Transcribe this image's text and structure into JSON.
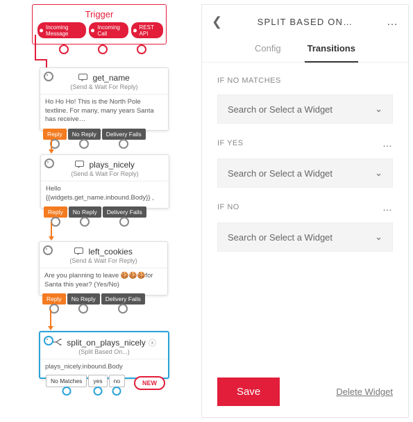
{
  "trigger": {
    "title": "Trigger",
    "tags": [
      "Incoming Message",
      "Incoming Call",
      "REST API"
    ]
  },
  "nodes": {
    "get_name": {
      "title": "get_name",
      "subtitle": "(Send & Wait For Reply)",
      "body": "Ho Ho Ho! This is the North Pole textline. For many, many years Santa has receive…",
      "tags": [
        "Reply",
        "No Reply",
        "Delivery Fails"
      ]
    },
    "plays_nicely": {
      "title": "plays_nicely",
      "subtitle": "(Send & Wait For Reply)",
      "body": "Hello {{widgets.get_name.inbound.Body}} ,",
      "tags": [
        "Reply",
        "No Reply",
        "Delivery Fails"
      ]
    },
    "left_cookies": {
      "title": "left_cookies",
      "subtitle": "(Send & Wait For Reply)",
      "body": "Are you planning to leave 🍪🍪🍪for Santa this year? (Yes/No)",
      "tags": [
        "Reply",
        "No Reply",
        "Delivery Fails"
      ]
    },
    "split": {
      "title": "split_on_plays_nicely",
      "subtitle": "(Split Based On...)",
      "body": "plays_nicely.inbound.Body",
      "tags": [
        "No Matches",
        "yes",
        "no"
      ],
      "new": "NEW"
    }
  },
  "panel": {
    "title": "SPLIT BASED ON…",
    "tabs": {
      "config": "Config",
      "transitions": "Transitions"
    },
    "sections": {
      "no_matches": {
        "label": "IF NO MATCHES",
        "placeholder": "Search or Select a Widget"
      },
      "yes": {
        "label": "IF YES",
        "placeholder": "Search or Select a Widget"
      },
      "no": {
        "label": "IF NO",
        "placeholder": "Search or Select a Widget"
      }
    },
    "save": "Save",
    "delete": "Delete Widget"
  }
}
